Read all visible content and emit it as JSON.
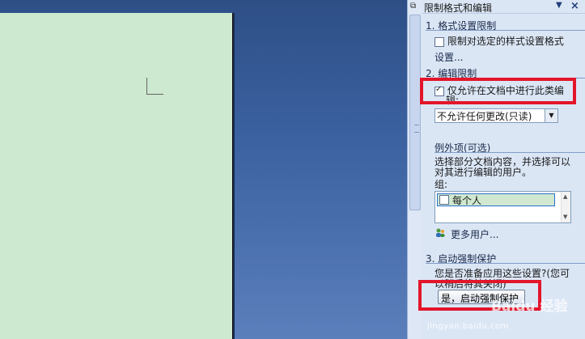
{
  "pane": {
    "title": "限制格式和编辑",
    "menu_glyph": "▼",
    "close_glyph": "×"
  },
  "section1": {
    "heading": "1. 格式设置限制",
    "checkbox_label": "限制对选定的样式设置格式",
    "checkbox_checked": false,
    "settings_link": "设置..."
  },
  "section2": {
    "heading": "2. 编辑限制",
    "checkbox_label_line1": "仅允许在文档中进行此类编",
    "checkbox_label_line2": "辑:",
    "checkbox_checked": true,
    "dropdown_value": "不允许任何更改(只读)",
    "exceptions_heading": "例外项(可选)",
    "exceptions_desc_line1": "选择部分文档内容，并选择可以",
    "exceptions_desc_line2": "对其进行编辑的用户。",
    "groups_label": "组:",
    "groups": [
      {
        "label": "每个人",
        "checked": false
      }
    ],
    "more_users_link": "更多用户..."
  },
  "section3": {
    "heading": "3. 启动强制保护",
    "question_line1": "您是否准备应用这些设置?(您可",
    "question_line2": "以稍后将其关闭)",
    "enforce_button": "是，启动强制保护"
  },
  "colors": {
    "page_background": "#cde9cf",
    "pane_background": "#dbe6f5",
    "highlight": "#e3152a"
  },
  "watermark": {
    "brand": "Baidu 经验",
    "url": "jingyan.baidu.com"
  }
}
